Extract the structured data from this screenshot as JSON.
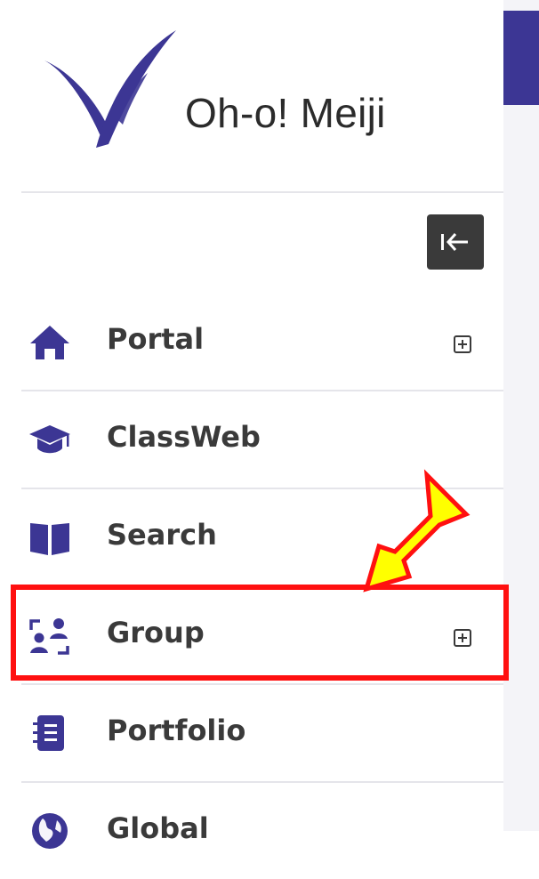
{
  "brand": {
    "name": "Oh-o! Meiji",
    "accent_color": "#3c3694"
  },
  "sidebar": {
    "collapse_icon": "collapse-left-icon",
    "items": [
      {
        "label": "Portal",
        "icon": "home-icon",
        "expandable": true
      },
      {
        "label": "ClassWeb",
        "icon": "graduation-cap-icon",
        "expandable": false
      },
      {
        "label": "Search",
        "icon": "book-icon",
        "expandable": false
      },
      {
        "label": "Group",
        "icon": "group-icon",
        "expandable": true,
        "highlighted": true
      },
      {
        "label": "Portfolio",
        "icon": "notebook-icon",
        "expandable": false
      },
      {
        "label": "Global",
        "icon": "globe-icon",
        "expandable": false
      }
    ]
  },
  "annotation": {
    "highlight_color": "#ff1010",
    "arrow_color": "#ffff00"
  }
}
